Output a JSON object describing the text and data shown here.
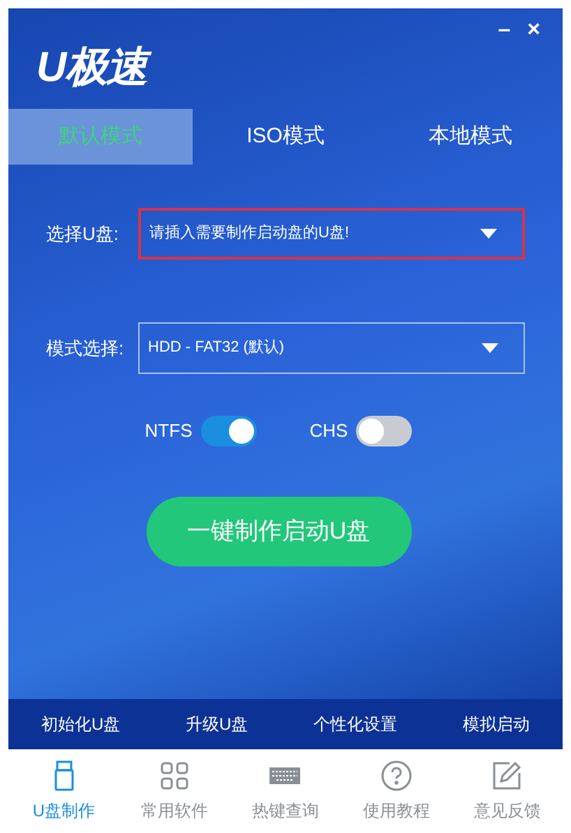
{
  "logo": "U极速",
  "window_controls": [
    "–",
    "×"
  ],
  "tabs": [
    {
      "label": "默认模式",
      "selected": true
    },
    {
      "label": "ISO模式",
      "selected": false
    },
    {
      "label": "本地模式",
      "selected": false
    }
  ],
  "fields": [
    {
      "label": "选择U盘:",
      "value": "请插入需要制作启动盘的U盘!",
      "highlighted": true
    },
    {
      "label": "模式选择:",
      "value": "HDD - FAT32 (默认)",
      "highlighted": false
    }
  ],
  "toggles": [
    {
      "label": "NTFS",
      "on": true
    },
    {
      "label": "CHS",
      "on": false
    }
  ],
  "primary_button": "一键制作启动U盘",
  "tool_links": [
    "初始化U盘",
    "升级U盘",
    "个性化设置",
    "模拟启动"
  ],
  "nav": [
    {
      "label": "U盘制作",
      "selected": true,
      "kind": "usb"
    },
    {
      "label": "常用软件",
      "selected": false,
      "kind": "apps"
    },
    {
      "label": "热键查询",
      "selected": false,
      "kind": "keyboard"
    },
    {
      "label": "使用教程",
      "selected": false,
      "kind": "help"
    },
    {
      "label": "意见反馈",
      "selected": false,
      "kind": "edit"
    }
  ]
}
